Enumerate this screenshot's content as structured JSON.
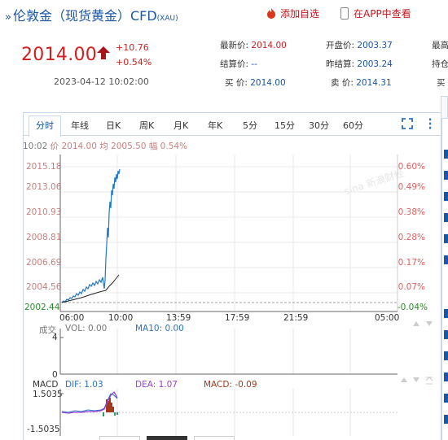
{
  "header": {
    "arrow": "»",
    "name": "伦敦金（现货黄金）CFD",
    "code": "(XAU)",
    "add_label": "添加自选",
    "app_label": "在APP中查看"
  },
  "quote": {
    "price": "2014.00",
    "change": "+10.76",
    "change_pct": "+0.54%",
    "timestamp": "2023-04-12 10:02:00"
  },
  "stats": {
    "latest_label": "最新价:",
    "latest": "2014.00",
    "open_label": "开盘价:",
    "open": "2003.37",
    "high_label": "最高",
    "settle_label": "结算价:",
    "settle": "--",
    "prev_settle_label": "昨结算:",
    "prev_settle": "2003.24",
    "hold_label": "持仓",
    "bid_label": "买  价:",
    "bid": "2014.00",
    "ask_label": "卖  价:",
    "ask": "2014.31",
    "right_cut": "买"
  },
  "tabs": [
    "分时",
    "年线",
    "日K",
    "周K",
    "月K",
    "年K",
    "5分",
    "15分",
    "30分",
    "60分"
  ],
  "info_line": {
    "time": "10:02",
    "price_label": "价",
    "price": "2014.00",
    "avg_label": "均",
    "avg": "2005.50",
    "rise_label": "幅",
    "rise": "0.54%"
  },
  "y_left": [
    "2015.18",
    "2013.06",
    "2010.93",
    "2008.81",
    "2006.69",
    "2004.56",
    "2002.44"
  ],
  "y_right": [
    "0.60%",
    "0.49%",
    "0.38%",
    "0.28%",
    "0.17%",
    "0.07%",
    "-0.04%"
  ],
  "x_ticks": [
    "06:00",
    "10:00",
    "13:59",
    "17:59",
    "21:59",
    "05:00"
  ],
  "watermark": "sina 新浪财经",
  "volume": {
    "title": "成交",
    "vol_label": "VOL: 0.00",
    "ma10_label": "MA10: 0.00",
    "y_top": "4",
    "y_bottom": "0"
  },
  "macd": {
    "title": "MACD",
    "dif_label": "DIF: 1.03",
    "dea_label": "DEA: 1.07",
    "macd_label": "MACD: -0.09",
    "y_top": "1.5035",
    "y_bottom": "-1.5035"
  },
  "colors": {
    "up": "#d21e1e",
    "link": "#1a56a8",
    "price_line": "#2277cc",
    "avg_line": "#222222",
    "dif_line": "#2c71c7",
    "dea_line": "#9b3fd6",
    "macd_bar": "#a23a1c"
  },
  "icons": {
    "fullscreen": "fullscreen-icon",
    "settings": "settings-icon"
  }
}
